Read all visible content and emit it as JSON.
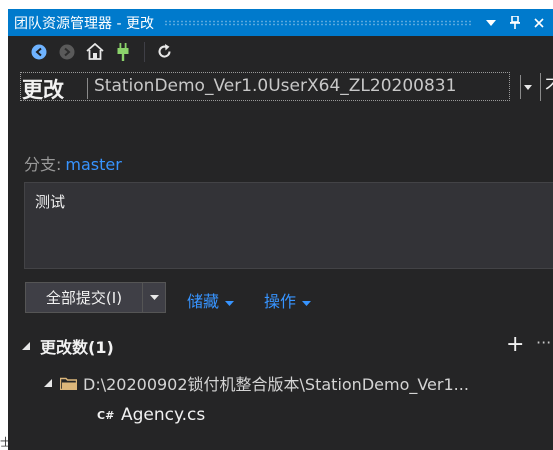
{
  "window": {
    "title": "团队资源管理器 - 更改"
  },
  "title_buttons": {
    "dropdown_icon": "triangle-down-icon",
    "pin_icon": "pin-icon",
    "close_icon": "close-icon"
  },
  "toolbar": {
    "items": [
      "back-icon",
      "forward-icon",
      "home-icon",
      "connect-plug-icon",
      "refresh-icon"
    ]
  },
  "header": {
    "page_title": "更改",
    "repository": "StationDemo_Ver1.0UserX64_ZL20200831",
    "more_text": "不"
  },
  "branch": {
    "label": "分支:",
    "name": "master"
  },
  "commit": {
    "message": "测试",
    "commit_button_label": "全部提交(I)",
    "stash_label": "储藏",
    "actions_label": "操作"
  },
  "changes": {
    "section_title": "更改数(1)",
    "add_symbol": "+",
    "more_symbol": "···",
    "folder_path": "D:\\20200902锁付机整合版本\\StationDemo_Ver1...",
    "files": [
      {
        "icon": "csharp-file-icon",
        "icon_text": "C#",
        "name": "Agency.cs"
      }
    ]
  },
  "stray_glyph": "士",
  "colors": {
    "accent": "#007acc",
    "link": "#3794ff",
    "panel_bg": "#252526",
    "folder": "#dcb67a",
    "plug": "#8bd36b",
    "nav_blue": "#6fb3ff"
  }
}
